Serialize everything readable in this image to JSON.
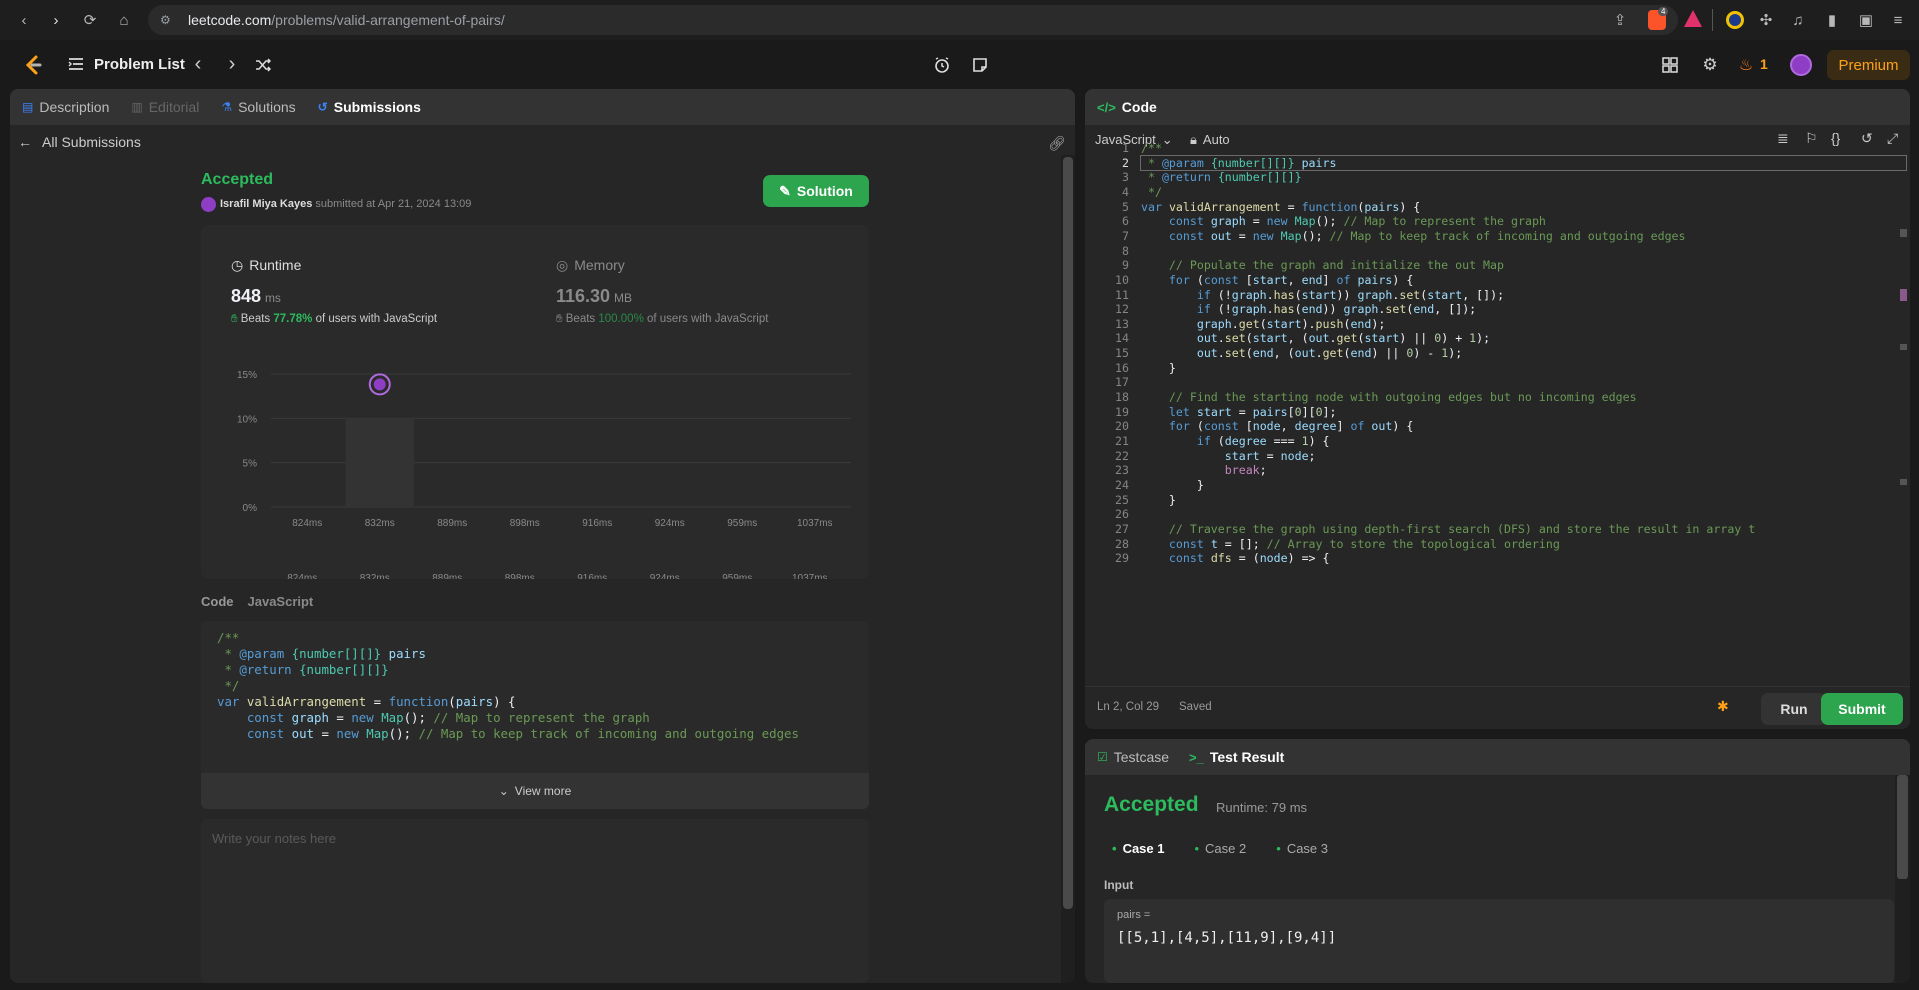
{
  "browser": {
    "url_domain": "leetcode.com",
    "url_path": "/problems/valid-arrangement-of-pairs/",
    "brave_badge": "4"
  },
  "header": {
    "problem_list": "Problem List",
    "streak": "1",
    "premium": "Premium"
  },
  "left_tabs": [
    "Description",
    "Editorial",
    "Solutions",
    "Submissions"
  ],
  "submission": {
    "back_label": "All Submissions",
    "status": "Accepted",
    "user": "Israfil Miya Kayes",
    "submitted_text": "submitted at Apr 21, 2024 13:09",
    "solution_button": "Solution",
    "runtime_label": "Runtime",
    "runtime_value": "848",
    "runtime_unit": "ms",
    "runtime_beats_prefix": "Beats",
    "runtime_beats": "77.78%",
    "runtime_beats_suffix": "of users with JavaScript",
    "memory_label": "Memory",
    "memory_value": "116.30",
    "memory_unit": "MB",
    "memory_beats_prefix": "Beats",
    "memory_beats": "100.00%",
    "memory_beats_suffix": "of users with JavaScript",
    "code_label": "Code",
    "code_lang": "JavaScript",
    "view_more": "View more",
    "notes_placeholder": "Write your notes here"
  },
  "chart_data": {
    "type": "bar",
    "categories": [
      "824ms",
      "832ms",
      "889ms",
      "898ms",
      "916ms",
      "924ms",
      "959ms",
      "1037ms"
    ],
    "values": [
      0,
      10,
      0,
      0,
      0,
      0,
      0,
      0
    ],
    "y_ticks": [
      "15%",
      "10%",
      "5%",
      "0%"
    ],
    "ylim": [
      0,
      15
    ],
    "grid": true,
    "marker_category": "832ms"
  },
  "code_snippet": [
    "/**",
    " * @param {number[][]} pairs",
    " * @return {number[][]}",
    " */",
    "var validArrangement = function(pairs) {",
    "    const graph = new Map(); // Map to represent the graph",
    "    const out = new Map(); // Map to keep track of incoming and outgoing edges"
  ],
  "editor": {
    "title": "Code",
    "language": "JavaScript",
    "mode": "Auto",
    "status_pos": "Ln 2, Col 29",
    "status_saved": "Saved",
    "run": "Run",
    "submit": "Submit",
    "lines": [
      "/**",
      " * @param {number[][]} pairs",
      " * @return {number[][]}",
      " */",
      "var validArrangement = function(pairs) {",
      "    const graph = new Map(); // Map to represent the graph",
      "    const out = new Map(); // Map to keep track of incoming and outgoing edges",
      "",
      "    // Populate the graph and initialize the out Map",
      "    for (const [start, end] of pairs) {",
      "        if (!graph.has(start)) graph.set(start, []);",
      "        if (!graph.has(end)) graph.set(end, []);",
      "        graph.get(start).push(end);",
      "        out.set(start, (out.get(start) || 0) + 1);",
      "        out.set(end, (out.get(end) || 0) - 1);",
      "    }",
      "",
      "    // Find the starting node with outgoing edges but no incoming edges",
      "    let start = pairs[0][0];",
      "    for (const [node, degree] of out) {",
      "        if (degree === 1) {",
      "            start = node;",
      "            break;",
      "        }",
      "    }",
      "",
      "    // Traverse the graph using depth-first search (DFS) and store the result in array t",
      "    const t = []; // Array to store the topological ordering",
      "    const dfs = (node) => {"
    ]
  },
  "testpanel": {
    "tab_testcase": "Testcase",
    "tab_result": "Test Result",
    "status": "Accepted",
    "runtime": "Runtime: 79 ms",
    "cases": [
      "Case 1",
      "Case 2",
      "Case 3"
    ],
    "input_label": "Input",
    "param_name": "pairs =",
    "param_value": "[[5,1],[4,5],[11,9],[9,4]]"
  }
}
